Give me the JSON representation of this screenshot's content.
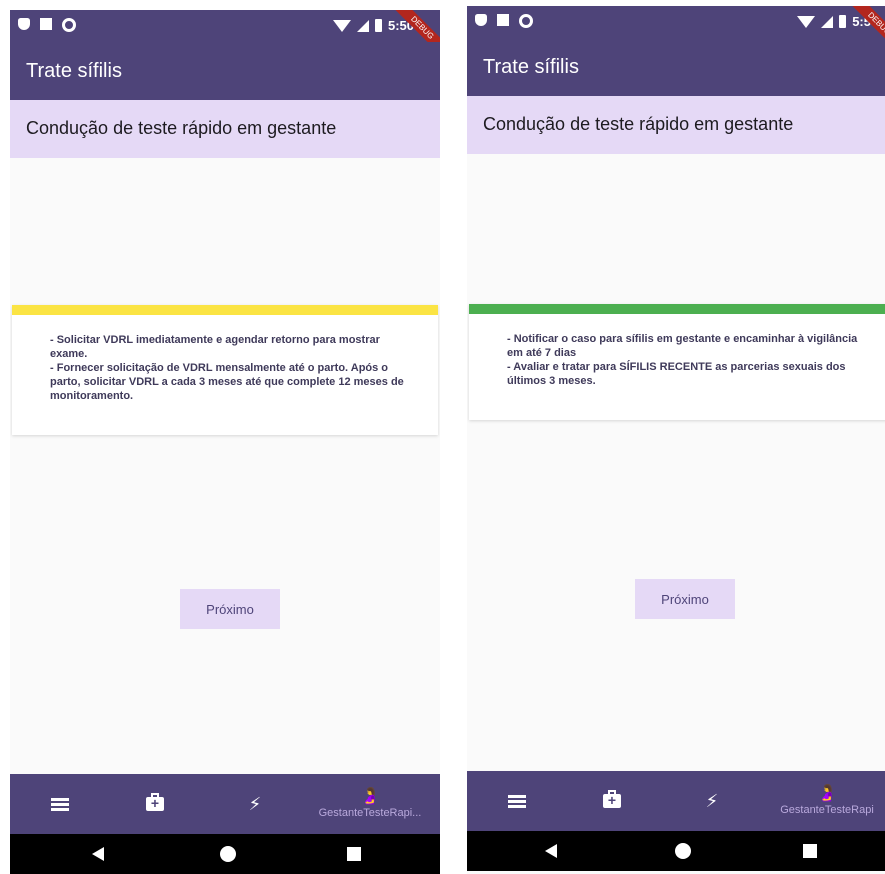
{
  "screens": [
    {
      "status": {
        "time": "5:50",
        "debug_banner": "DEBUG"
      },
      "appbar": {
        "title": "Trate sífilis"
      },
      "subheader": {
        "text": "Condução de teste rápido em gestante"
      },
      "card": {
        "bar_color": "#fbe444",
        "lines": [
          "- Solicitar VDRL imediatamente e agendar retorno para mostrar exame.",
          "- Fornecer solicitação de VDRL mensalmente até o parto. Após o parto, solicitar VDRL a cada 3 meses até que complete 12 meses de monitoramento."
        ]
      },
      "next_label": "Próximo",
      "bottom_nav": {
        "items": [
          "menu-icon",
          "medical-kit-icon",
          "bolt-icon",
          "pregnant-woman-icon"
        ],
        "label": "GestanteTesteRapi..."
      }
    },
    {
      "status": {
        "time": "5:5",
        "debug_banner": "DEBUG"
      },
      "appbar": {
        "title": "Trate sífilis"
      },
      "subheader": {
        "text": "Condução de teste rápido em gestante"
      },
      "card": {
        "bar_color": "#4caf50",
        "lines": [
          "- Notificar o caso para sífilis em gestante e encaminhar à vigilância em até 7 dias",
          "- Avaliar e tratar para SÍFILIS RECENTE as parcerias sexuais dos últimos 3 meses."
        ]
      },
      "next_label": "Próximo",
      "bottom_nav": {
        "items": [
          "menu-icon",
          "medical-kit-icon",
          "bolt-icon",
          "pregnant-woman-icon"
        ],
        "label": "GestanteTesteRapi"
      }
    }
  ]
}
